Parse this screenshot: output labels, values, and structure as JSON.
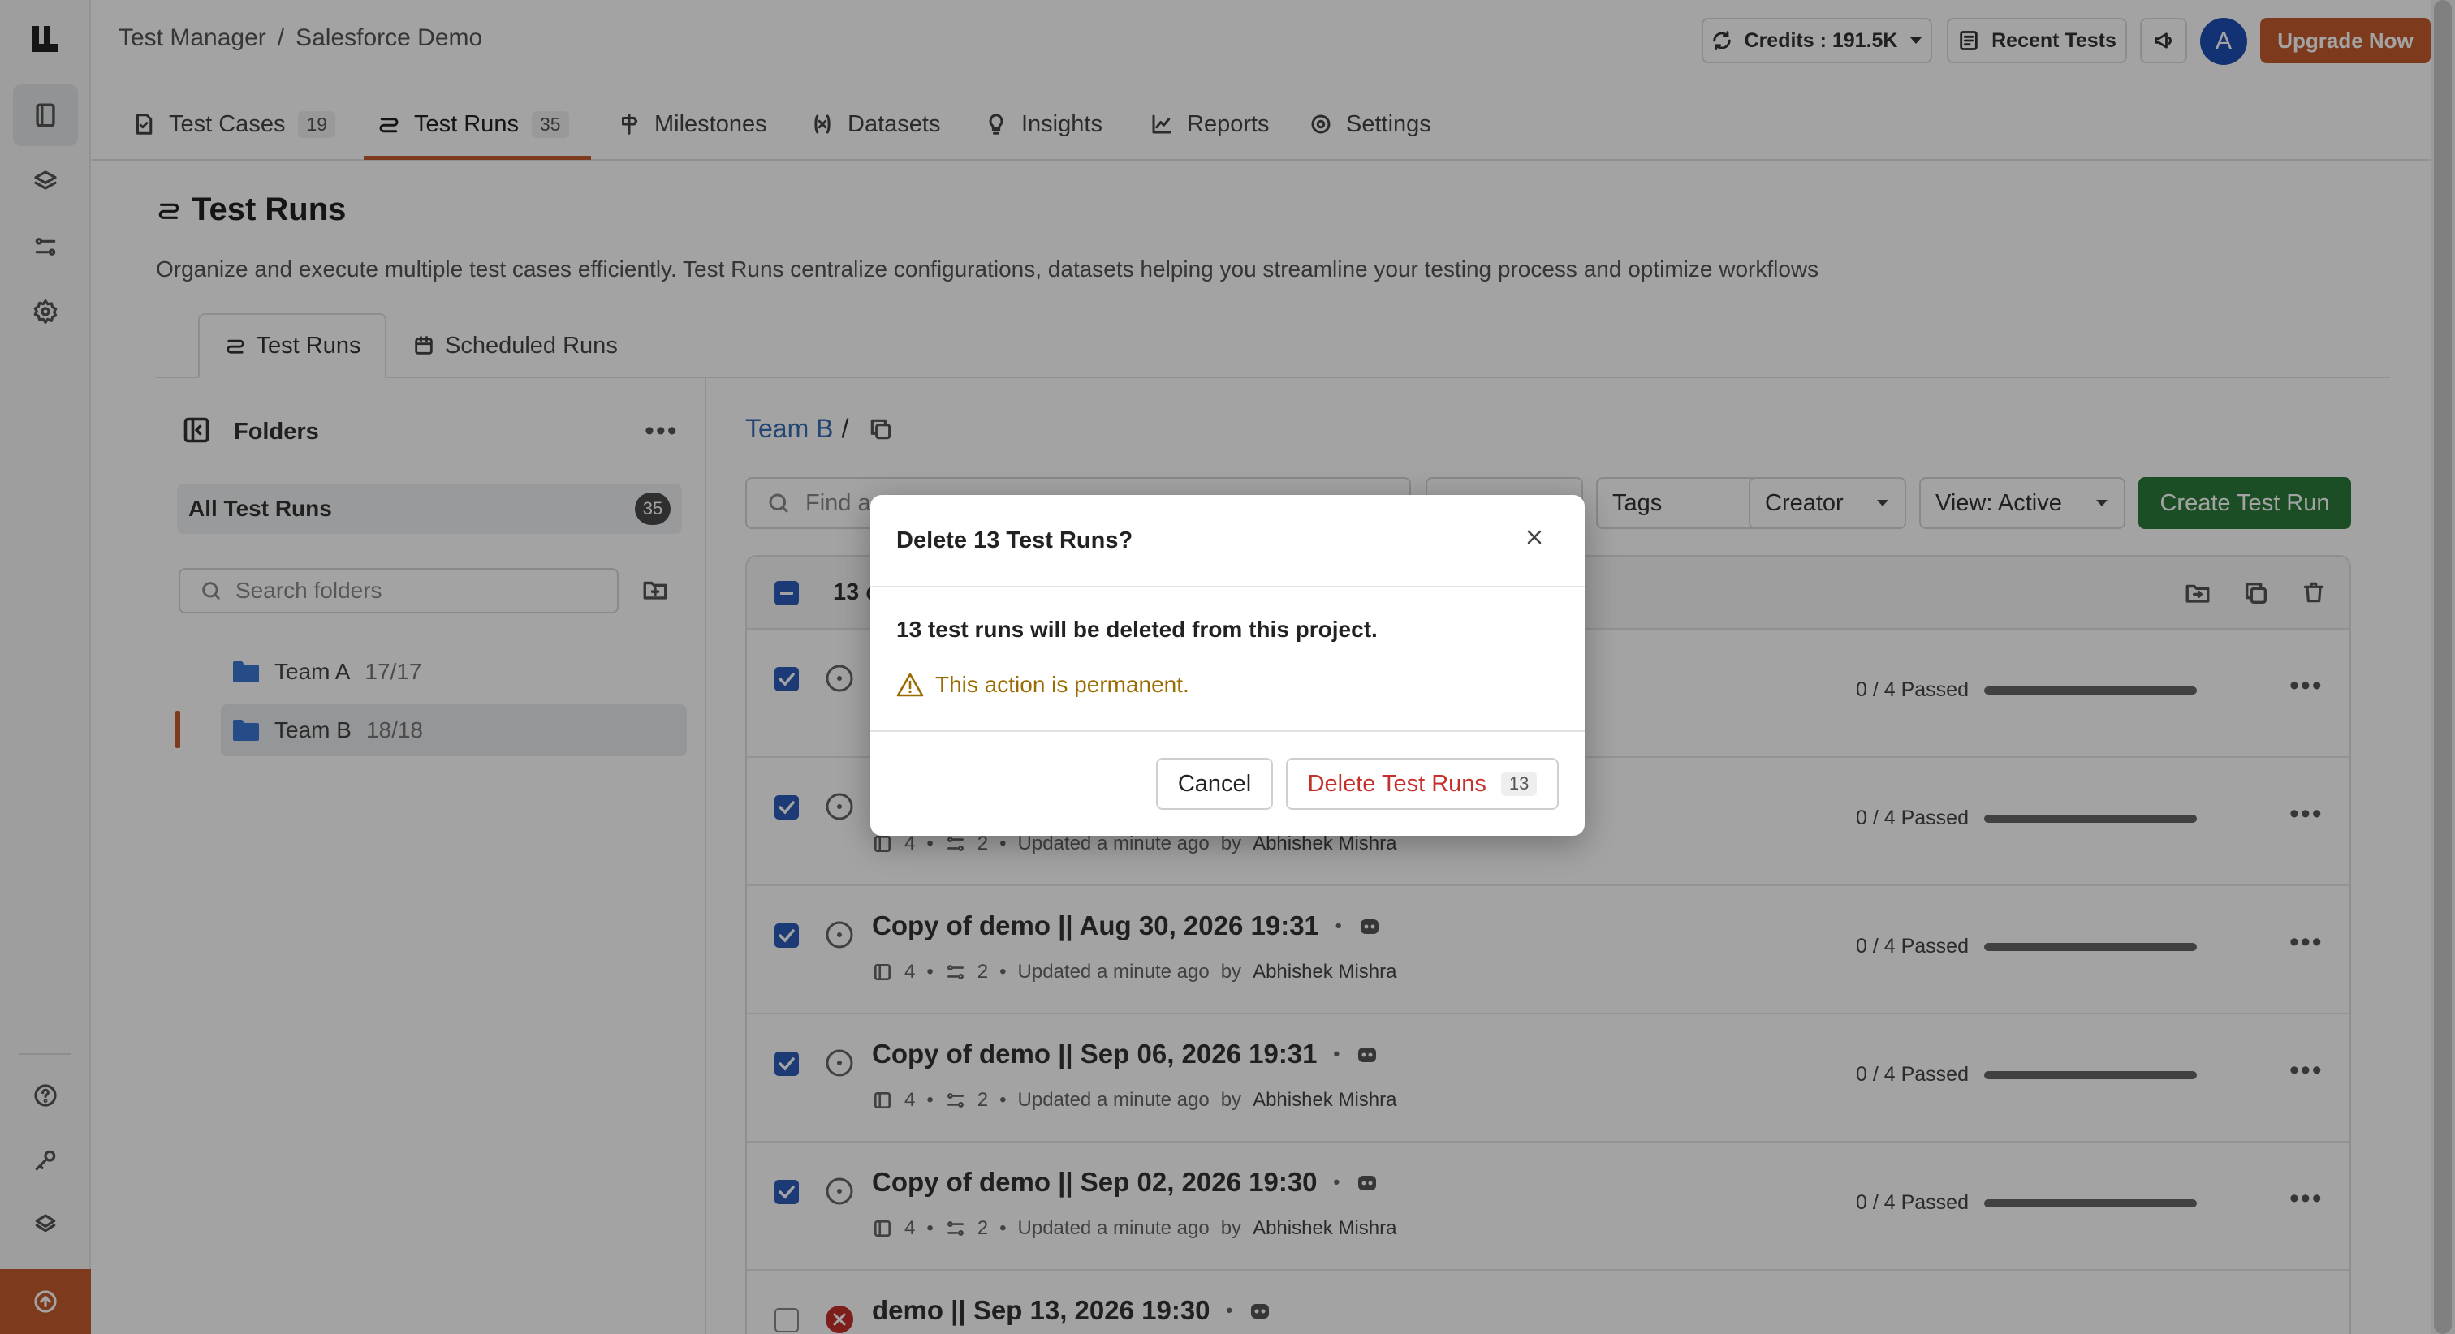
{
  "breadcrumb": {
    "root": "Test Manager",
    "sep": "/",
    "project": "Salesforce Demo"
  },
  "topbar": {
    "credits_label": "Credits : 191.5K",
    "recent_tests": "Recent Tests",
    "avatar_initial": "A",
    "upgrade": "Upgrade Now"
  },
  "nav": {
    "tabs": [
      {
        "label": "Test Cases",
        "badge": "19"
      },
      {
        "label": "Test Runs",
        "badge": "35"
      },
      {
        "label": "Milestones"
      },
      {
        "label": "Datasets"
      },
      {
        "label": "Insights"
      },
      {
        "label": "Reports"
      },
      {
        "label": "Settings"
      }
    ],
    "active": "Test Runs"
  },
  "page": {
    "title": "Test Runs",
    "description": "Organize and execute multiple test cases efficiently. Test Runs centralize configurations, datasets helping you streamline your testing process and optimize workflows"
  },
  "subtabs": {
    "runs": "Test Runs",
    "scheduled": "Scheduled Runs"
  },
  "folders": {
    "title": "Folders",
    "all_label": "All Test Runs",
    "all_count": "35",
    "search_placeholder": "Search folders",
    "items": [
      {
        "name": "Team A",
        "count": "17/17"
      },
      {
        "name": "Team B",
        "count": "18/18",
        "selected": true
      }
    ]
  },
  "main": {
    "crumb": "Team B",
    "crumb_sep": "/",
    "search_placeholder": "Find a",
    "filters": {
      "tags": "Tags",
      "creator": "Creator",
      "view": "View: Active"
    },
    "create_button": "Create Test Run",
    "selected_prefix": "13 c"
  },
  "rows": [
    {
      "title": "",
      "steps": "",
      "flows": "",
      "updated": "",
      "by": "",
      "passed": "0 / 4 Passed",
      "checked": true,
      "status": "pending"
    },
    {
      "title": "",
      "steps": "4",
      "flows": "2",
      "updated": "Updated a minute ago",
      "by_label": "by",
      "by": "Abhishek Mishra",
      "passed": "0 / 4 Passed",
      "checked": true,
      "status": "pending"
    },
    {
      "title": "Copy of demo || Aug 30, 2026 19:31",
      "steps": "4",
      "flows": "2",
      "updated": "Updated a minute ago",
      "by_label": "by",
      "by": "Abhishek Mishra",
      "passed": "0 / 4 Passed",
      "checked": true,
      "status": "pending"
    },
    {
      "title": "Copy of demo || Sep 06, 2026 19:31",
      "steps": "4",
      "flows": "2",
      "updated": "Updated a minute ago",
      "by_label": "by",
      "by": "Abhishek Mishra",
      "passed": "0 / 4 Passed",
      "checked": true,
      "status": "pending"
    },
    {
      "title": "Copy of demo || Sep 02, 2026 19:30",
      "steps": "4",
      "flows": "2",
      "updated": "Updated a minute ago",
      "by_label": "by",
      "by": "Abhishek Mishra",
      "passed": "0 / 4 Passed",
      "checked": true,
      "status": "pending"
    },
    {
      "title": "demo || Sep 13, 2026 19:30",
      "checked": false,
      "status": "failed"
    }
  ],
  "modal": {
    "title": "Delete 13 Test Runs?",
    "message": "13 test runs will be deleted from this project.",
    "warning": "This action is permanent.",
    "cancel": "Cancel",
    "confirm": "Delete Test Runs",
    "confirm_count": "13"
  },
  "colors": {
    "accent": "#c65b2c",
    "primary_blue": "#2d5cb8",
    "create_green": "#2c7a3c",
    "danger_red": "#c5302a",
    "warning": "#9a6b00"
  }
}
